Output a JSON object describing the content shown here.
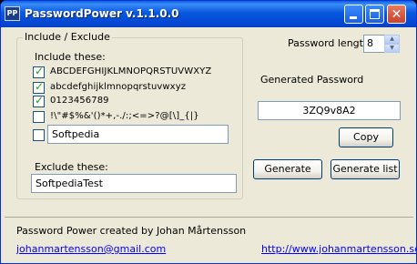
{
  "window": {
    "title": "PasswordPower v.1.1.0.0",
    "icon_text": "PP",
    "minimize_label": "",
    "close_glyph": "✕"
  },
  "include_exclude": {
    "legend": "Include / Exclude",
    "include_label": "Include these:",
    "options": [
      {
        "text": "ABCDEFGHIJKLMNOPQRSTUVWXYZ",
        "checked": true
      },
      {
        "text": "abcdefghijklmnopqrstuvwxyz",
        "checked": true
      },
      {
        "text": "0123456789",
        "checked": true
      },
      {
        "text": "!\\\"#$%&'()*+,-./:;<=>?@[\\]_{|}",
        "checked": false
      }
    ],
    "custom_checked": false,
    "custom_value": "Softpedia",
    "exclude_label": "Exclude these:",
    "exclude_value": "SoftpediaTest"
  },
  "password_length": {
    "label": "Password length:",
    "value": "8"
  },
  "generated": {
    "legend": "Generated Password",
    "value": "3ZQ9v8A2",
    "copy_label": "Copy"
  },
  "buttons": {
    "generate": "Generate",
    "generate_list": "Generate list"
  },
  "footer": {
    "credit": "Password Power created by Johan Mårtensson",
    "email": "johanmartensson@gmail.com",
    "url": "http://www.johanmartensson.se"
  },
  "colors": {
    "titlebar": "#0858e0",
    "link": "#0000ff",
    "window_bg": "#ece9d8",
    "check": "#21a121"
  }
}
